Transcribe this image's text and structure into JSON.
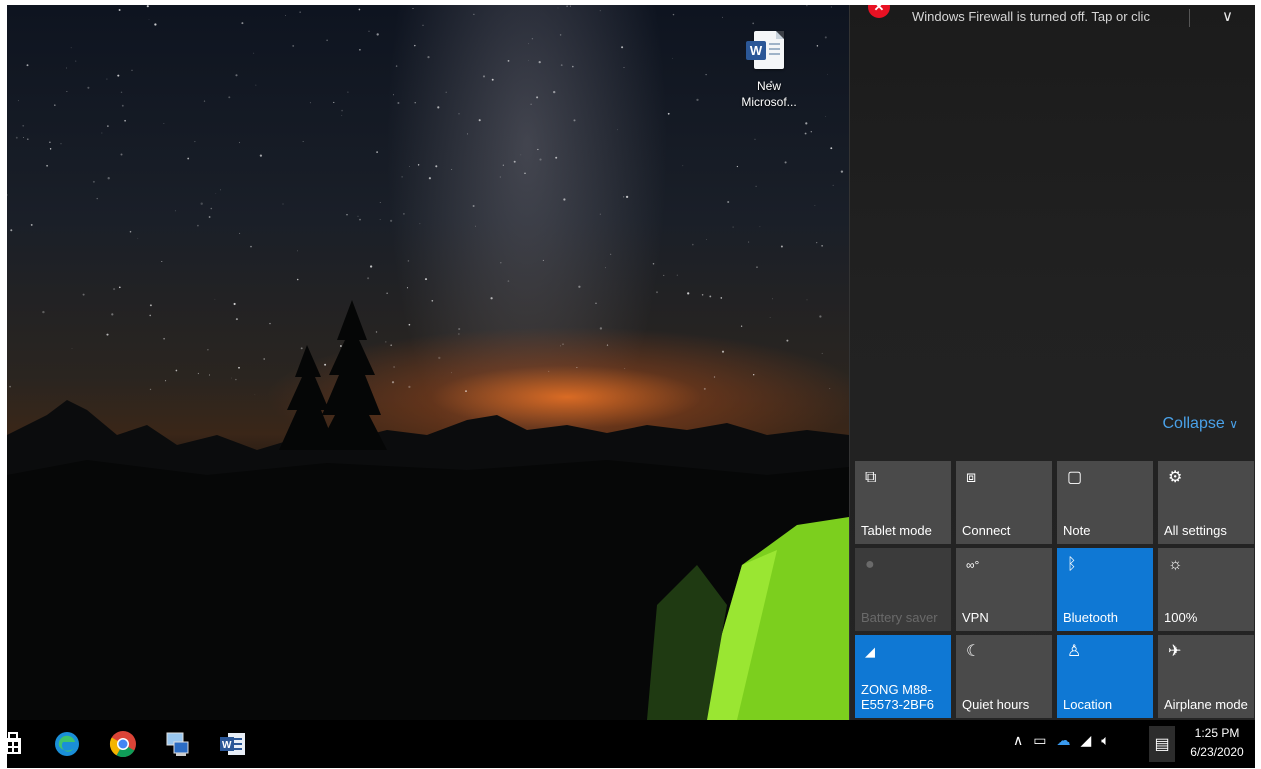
{
  "desktop": {
    "icon": {
      "label": "New\nMicrosof...",
      "icon": "word-document-icon"
    }
  },
  "action_center": {
    "notification": {
      "text": "Windows Firewall is turned off. Tap or clic",
      "icon": "error-icon",
      "chevron": "chevron-down-icon"
    },
    "collapse_label": "Collapse",
    "collapse_chevron": "∨",
    "quick_actions": [
      {
        "label": "Tablet mode",
        "icon": "tablet-mode-icon",
        "active": false
      },
      {
        "label": "Connect",
        "icon": "connect-icon",
        "active": false
      },
      {
        "label": "Note",
        "icon": "note-icon",
        "active": false
      },
      {
        "label": "All settings",
        "icon": "gear-icon",
        "active": false
      },
      {
        "label": "Battery saver",
        "icon": "battery-saver-icon",
        "active": false,
        "disabled": true
      },
      {
        "label": "VPN",
        "icon": "vpn-icon",
        "active": false
      },
      {
        "label": "Bluetooth",
        "icon": "bluetooth-icon",
        "active": true
      },
      {
        "label": "100%",
        "icon": "brightness-icon",
        "active": false
      },
      {
        "label": "ZONG M88-\nE5573-2BF6",
        "icon": "wifi-icon",
        "active": true
      },
      {
        "label": "Quiet hours",
        "icon": "moon-icon",
        "active": false
      },
      {
        "label": "Location",
        "icon": "location-icon",
        "active": true
      },
      {
        "label": "Airplane mode",
        "icon": "airplane-icon",
        "active": false
      }
    ]
  },
  "taskbar": {
    "apps": [
      {
        "name": "store-app",
        "icon": "store-icon"
      },
      {
        "name": "edge-app",
        "icon": "edge-icon"
      },
      {
        "name": "chrome-app",
        "icon": "chrome-icon"
      },
      {
        "name": "network-app",
        "icon": "network-computer-icon"
      },
      {
        "name": "word-app",
        "icon": "word-icon"
      }
    ],
    "tray": [
      "chevron-up-icon",
      "battery-icon",
      "onedrive-icon",
      "wifi-icon",
      "volume-icon"
    ],
    "clock": {
      "time": "1:25 PM",
      "date": "6/23/2020"
    }
  },
  "colors": {
    "accent": "#0f78d4",
    "link": "#4aa1e8",
    "error": "#e81123",
    "tile": "#4a4a4a"
  }
}
